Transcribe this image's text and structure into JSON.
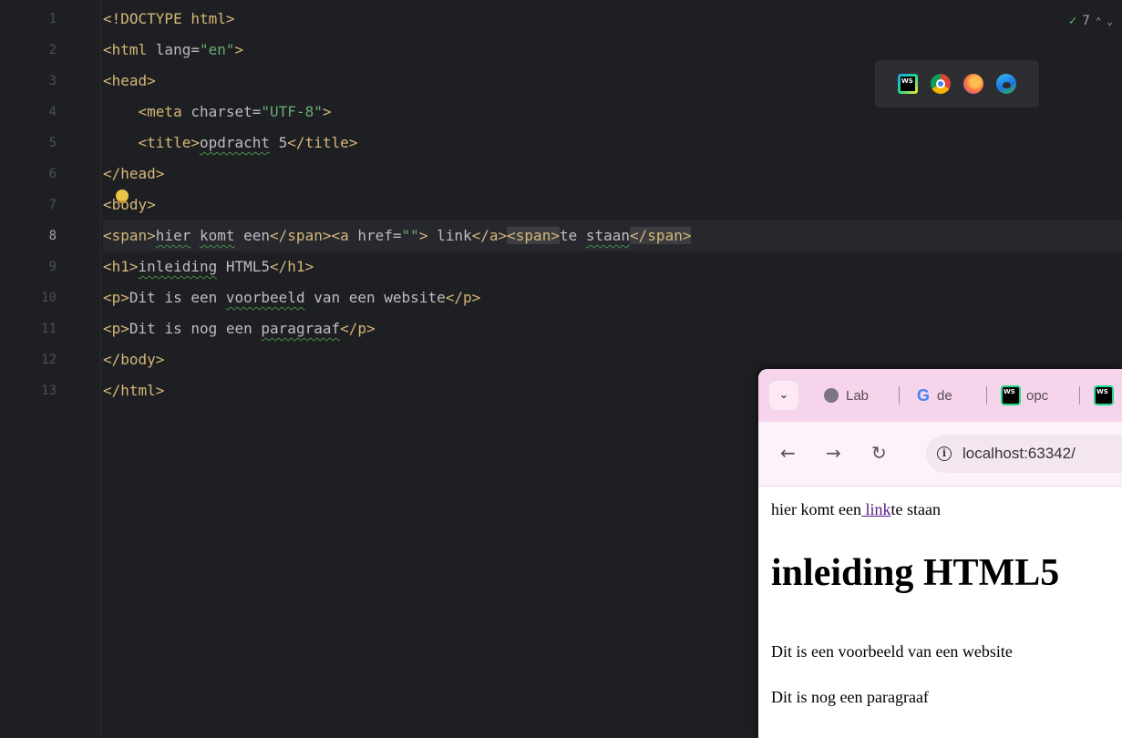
{
  "editor": {
    "line_numbers": [
      "1",
      "2",
      "3",
      "4",
      "5",
      "6",
      "7",
      "8",
      "9",
      "10",
      "11",
      "12",
      "13"
    ],
    "current_line": "8",
    "inspection_count": "7",
    "lines": [
      [
        "<!DOCTYPE html>"
      ],
      [
        "<html ",
        "lang",
        "=",
        "\"en\"",
        ">"
      ],
      [
        "<head>"
      ],
      [
        "    ",
        "<meta ",
        "charset",
        "=",
        "\"UTF-8\"",
        ">"
      ],
      [
        "    ",
        "<title>",
        "opdracht",
        " 5",
        "</title>"
      ],
      [
        "</head>"
      ],
      [
        "<body>"
      ],
      [
        "<span>",
        "hier",
        " ",
        "komt",
        " een",
        "</span>",
        "<a ",
        "href",
        "=",
        "\"\"",
        ">",
        " link",
        "</a>",
        "<span>",
        "te ",
        "staan",
        "</span>"
      ],
      [
        "<h1>",
        "inleiding",
        " HTML5",
        "</h1>"
      ],
      [
        "<p>",
        "Dit is een ",
        "voorbeeld",
        " van een website",
        "</p>"
      ],
      [
        "<p>",
        "Dit is nog een ",
        "paragraaf",
        "</p>"
      ],
      [
        "</body>"
      ],
      [
        "</html>"
      ]
    ]
  },
  "browser_icons": [
    "webstorm-icon",
    "chrome-icon",
    "firefox-icon",
    "edge-icon"
  ],
  "browser": {
    "tabs": [
      {
        "icon": "globe-icon",
        "label": "Lab"
      },
      {
        "icon": "google-icon",
        "label": "de"
      },
      {
        "icon": "webstorm-icon",
        "label": "opc"
      }
    ],
    "address": "localhost:63342/",
    "page": {
      "line1_before": "hier komt een",
      "line1_link": " link",
      "line1_after": "te staan",
      "h1": "inleiding HTML5",
      "p1": "Dit is een voorbeeld van een website",
      "p2": "Dit is nog een paragraaf"
    }
  },
  "colors": {
    "editor_bg": "#1e1f22",
    "tag": "#d5b778",
    "string": "#6aab73",
    "text": "#bcbec4",
    "browser_tabbar": "#f5d4ec",
    "link": "#551a8b"
  }
}
